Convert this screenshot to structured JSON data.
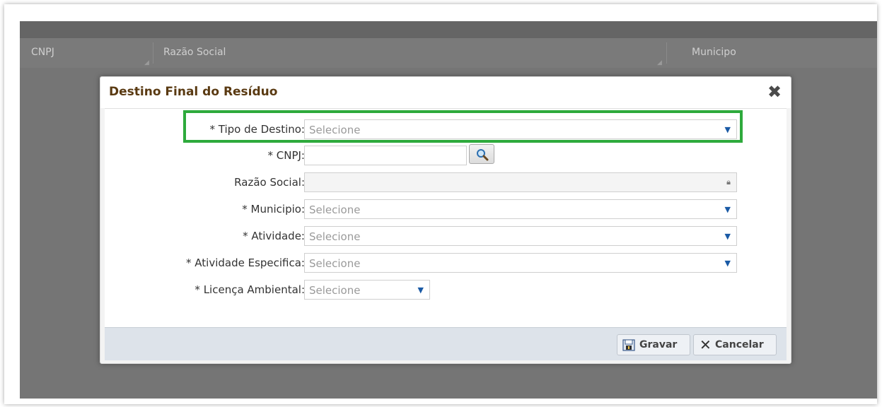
{
  "background_table": {
    "columns": [
      "CNPJ",
      "Razão Social",
      "Municipo"
    ]
  },
  "modal": {
    "title": "Destino Final do Resíduo",
    "close_icon": "close-x-icon",
    "fields": {
      "tipo_destino": {
        "label": "* Tipo de Destino:",
        "placeholder": "Selecione"
      },
      "cnpj": {
        "label": "* CNPJ:",
        "value": ""
      },
      "razao_social": {
        "label": "Razão Social:",
        "value": ""
      },
      "municipio": {
        "label": "* Municipio:",
        "placeholder": "Selecione"
      },
      "atividade": {
        "label": "* Atividade:",
        "placeholder": "Selecione"
      },
      "atividade_especifica": {
        "label": "* Atividade Especifica:",
        "placeholder": "Selecione"
      },
      "licenca_ambiental": {
        "label": "* Licença Ambiental:",
        "placeholder": "Selecione"
      }
    },
    "buttons": {
      "gravar": "Gravar",
      "cancelar": "Cancelar"
    }
  },
  "highlight_color": "#2eaa3c"
}
